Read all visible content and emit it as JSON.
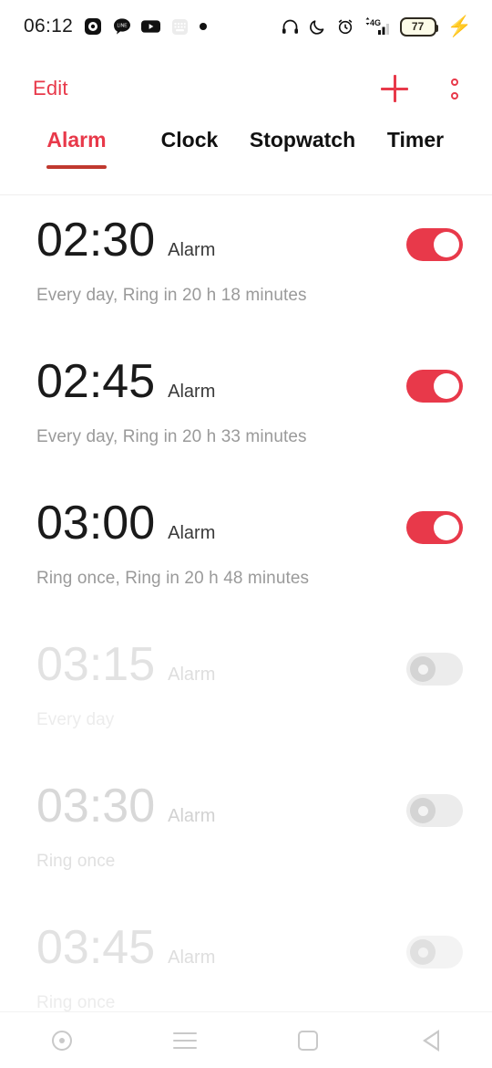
{
  "status_bar": {
    "time": "06:12",
    "left_icons": [
      "camera-record-icon",
      "line-app-icon",
      "youtube-icon",
      "keyboard-icon",
      "dot-indicator-icon"
    ],
    "right_icons": [
      "headphones-icon",
      "do-not-disturb-moon-icon",
      "alarm-set-icon",
      "signal-4g-icon"
    ],
    "network_label": "4G",
    "battery_percent": "77",
    "charging": true
  },
  "toolbar": {
    "edit_label": "Edit",
    "add_icon": "plus-icon",
    "overflow_icon": "two-dot-menu-icon"
  },
  "tabs": [
    {
      "label": "Alarm",
      "active": true
    },
    {
      "label": "Clock",
      "active": false
    },
    {
      "label": "Stopwatch",
      "active": false
    },
    {
      "label": "Timer",
      "active": false
    }
  ],
  "alarms": [
    {
      "time": "02:30",
      "label": "Alarm",
      "subtitle": "Every day, Ring in 20 h 18 minutes",
      "enabled": true
    },
    {
      "time": "02:45",
      "label": "Alarm",
      "subtitle": "Every day, Ring in 20 h 33 minutes",
      "enabled": true
    },
    {
      "time": "03:00",
      "label": "Alarm",
      "subtitle": "Ring once, Ring in 20 h 48 minutes",
      "enabled": true
    },
    {
      "time": "03:15",
      "label": "Alarm",
      "subtitle": "Every day",
      "enabled": false
    },
    {
      "time": "03:30",
      "label": "Alarm",
      "subtitle": "Ring once",
      "enabled": false
    },
    {
      "time": "03:45",
      "label": "Alarm",
      "subtitle": "Ring once",
      "enabled": false
    }
  ],
  "nav_bar": {
    "items": [
      "assistant-circle-icon",
      "menu-lines-icon",
      "recents-square-icon",
      "back-triangle-icon"
    ]
  },
  "colors": {
    "accent": "#e8394a",
    "tab_underline": "#c0392f",
    "toggle_off": "#ececec",
    "subtitle": "#9a9a9a"
  }
}
